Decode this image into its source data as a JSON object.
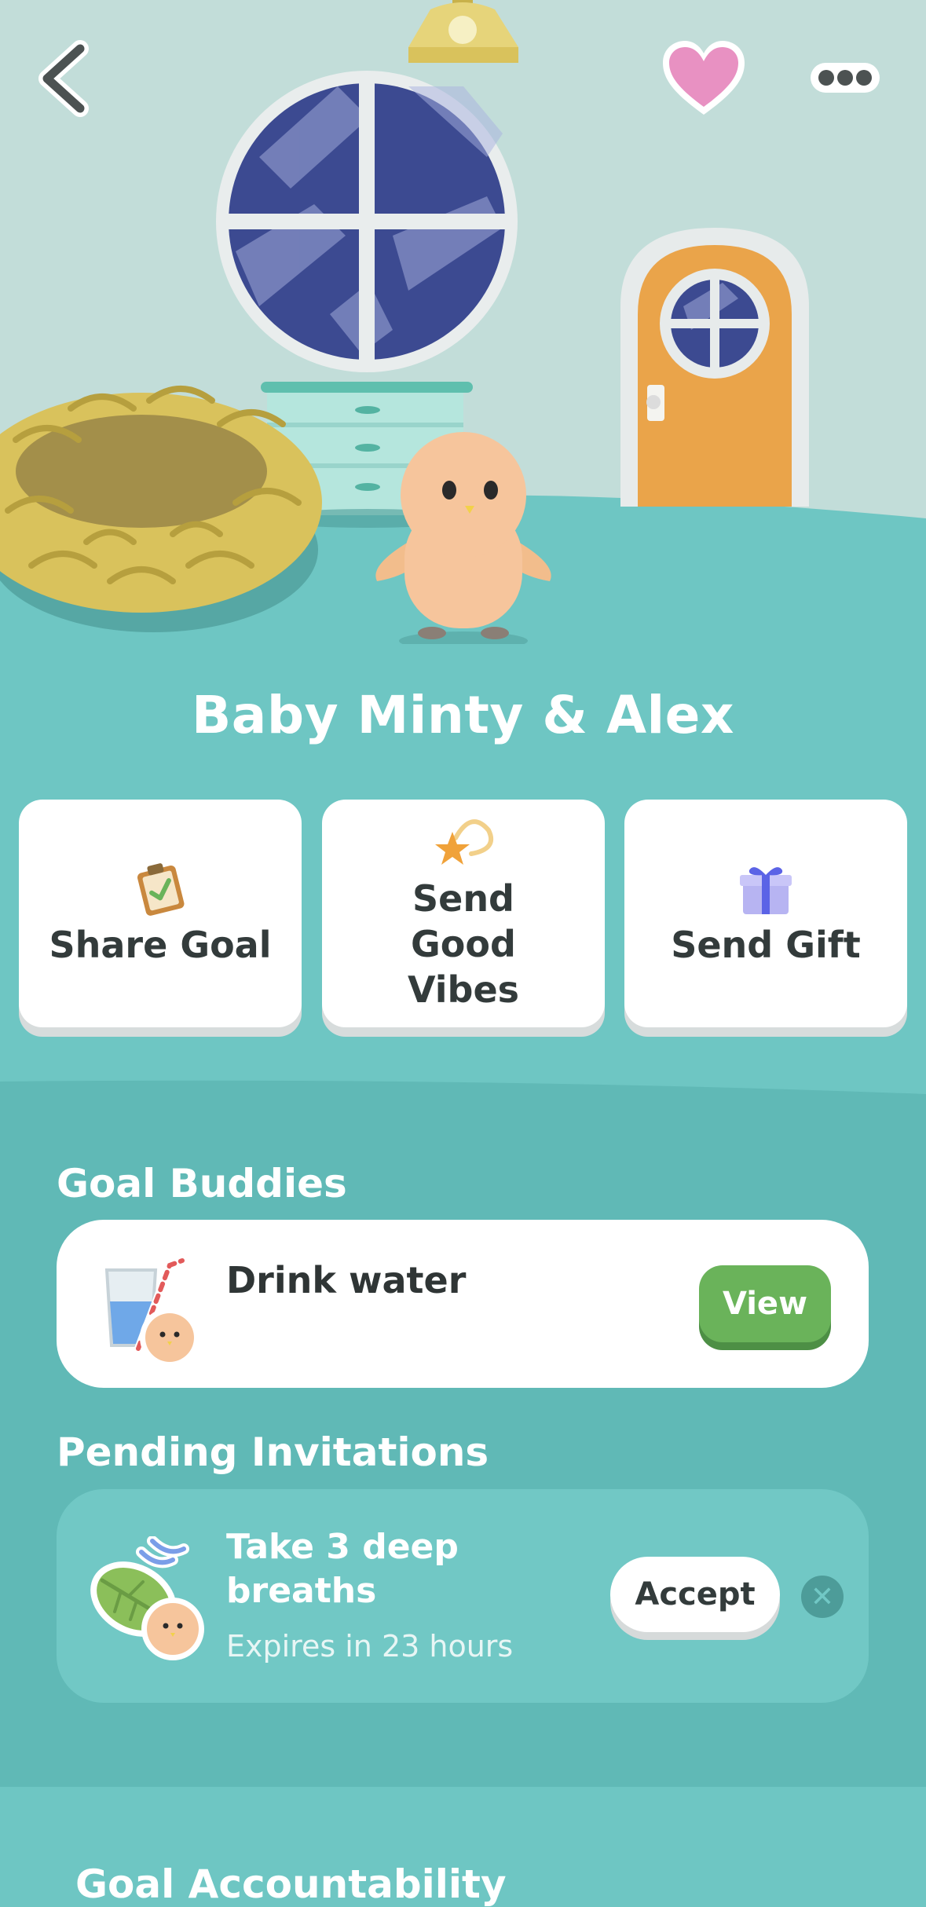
{
  "header": {
    "back_icon": "chevron-left-icon",
    "favorite_icon": "heart-icon",
    "more_icon": "ellipsis-icon"
  },
  "pet": {
    "title": "Baby Minty & Alex"
  },
  "actions": [
    {
      "label": "Share Goal",
      "icon": "clipboard-check-icon"
    },
    {
      "label": "Send Good Vibes",
      "icon": "shooting-star-icon"
    },
    {
      "label": "Send Gift",
      "icon": "gift-icon"
    }
  ],
  "goal_buddies": {
    "title": "Goal Buddies",
    "items": [
      {
        "name": "Drink water",
        "button": "View",
        "icon": "water-glass-icon"
      }
    ]
  },
  "pending_invitations": {
    "title": "Pending Invitations",
    "items": [
      {
        "name": "Take 3 deep breaths",
        "expires": "Expires in 23 hours",
        "button": "Accept",
        "icon": "leaf-wind-icon"
      }
    ]
  },
  "next_section": {
    "title": "Goal Accountability"
  },
  "colors": {
    "background": "#6ec6c3",
    "wall": "#c2ddd9",
    "accent_green": "#6ab35a",
    "heart_pink": "#e891c2",
    "door_orange": "#eaa44a"
  }
}
